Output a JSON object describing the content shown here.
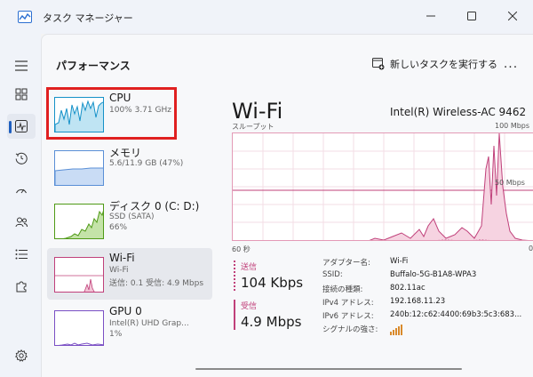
{
  "window": {
    "title": "タスク マネージャー"
  },
  "header": {
    "title": "パフォーマンス",
    "run_task_label": "新しいタスクを実行する",
    "more_label": "..."
  },
  "nav": {
    "items": [
      {
        "name": "processes",
        "icon": "hamburger-menu-icon"
      },
      {
        "name": "processes-tab",
        "icon": "grid-icon"
      },
      {
        "name": "performance-tab",
        "icon": "performance-chart-icon",
        "active": true
      },
      {
        "name": "app-history-tab",
        "icon": "history-icon"
      },
      {
        "name": "startup-apps-tab",
        "icon": "speedometer-icon"
      },
      {
        "name": "users-tab",
        "icon": "users-icon"
      },
      {
        "name": "details-tab",
        "icon": "list-icon"
      },
      {
        "name": "services-tab",
        "icon": "puzzle-icon"
      },
      {
        "name": "settings",
        "icon": "gear-icon"
      }
    ]
  },
  "side_items": [
    {
      "key": "cpu",
      "name": "CPU",
      "sub1": "100%  3.71 GHz",
      "sub2": "",
      "sub3": ""
    },
    {
      "key": "memory",
      "name": "メモリ",
      "sub1": "5.6/11.9 GB (47%)",
      "sub2": "",
      "sub3": ""
    },
    {
      "key": "disk",
      "name": "ディスク 0 (C: D:)",
      "sub1": "SSD (SATA)",
      "sub2": "66%",
      "sub3": ""
    },
    {
      "key": "wifi",
      "name": "Wi-Fi",
      "sub1": "Wi-Fi",
      "sub2": "送信: 0.1  受信: 4.9 Mbps",
      "sub3": "",
      "selected": true
    },
    {
      "key": "gpu",
      "name": "GPU 0",
      "sub1": "Intel(R) UHD Grap...",
      "sub2": "1%",
      "sub3": ""
    }
  ],
  "detail": {
    "title": "Wi-Fi",
    "device": "Intel(R) Wireless-AC 9462",
    "throughput_label": "スループット",
    "max_label": "100 Mbps",
    "mid_label": "50 Mbps",
    "time_label": "60 秒",
    "zero_label": "0",
    "send": {
      "label": "送信",
      "value": "104 Kbps"
    },
    "receive": {
      "label": "受信",
      "value": "4.9 Mbps"
    },
    "properties": [
      {
        "key": "アダプター名:",
        "value": "Wi-Fi"
      },
      {
        "key": "SSID:",
        "value": "Buffalo-5G-B1A8-WPA3"
      },
      {
        "key": "接続の種類:",
        "value": "802.11ac"
      },
      {
        "key": "IPv4 アドレス:",
        "value": "192.168.11.23"
      },
      {
        "key": "IPv6 アドレス:",
        "value": "240b:12:c62:4400:69b3:5c3:683..."
      },
      {
        "key": "シグナルの強さ:",
        "value": ""
      }
    ]
  },
  "colors": {
    "cpu": "#1591c8",
    "memory": "#5a8fd6",
    "disk": "#4f9a16",
    "network": "#c0407a",
    "gpu": "#7a4fc4",
    "highlight": "#e02020"
  }
}
